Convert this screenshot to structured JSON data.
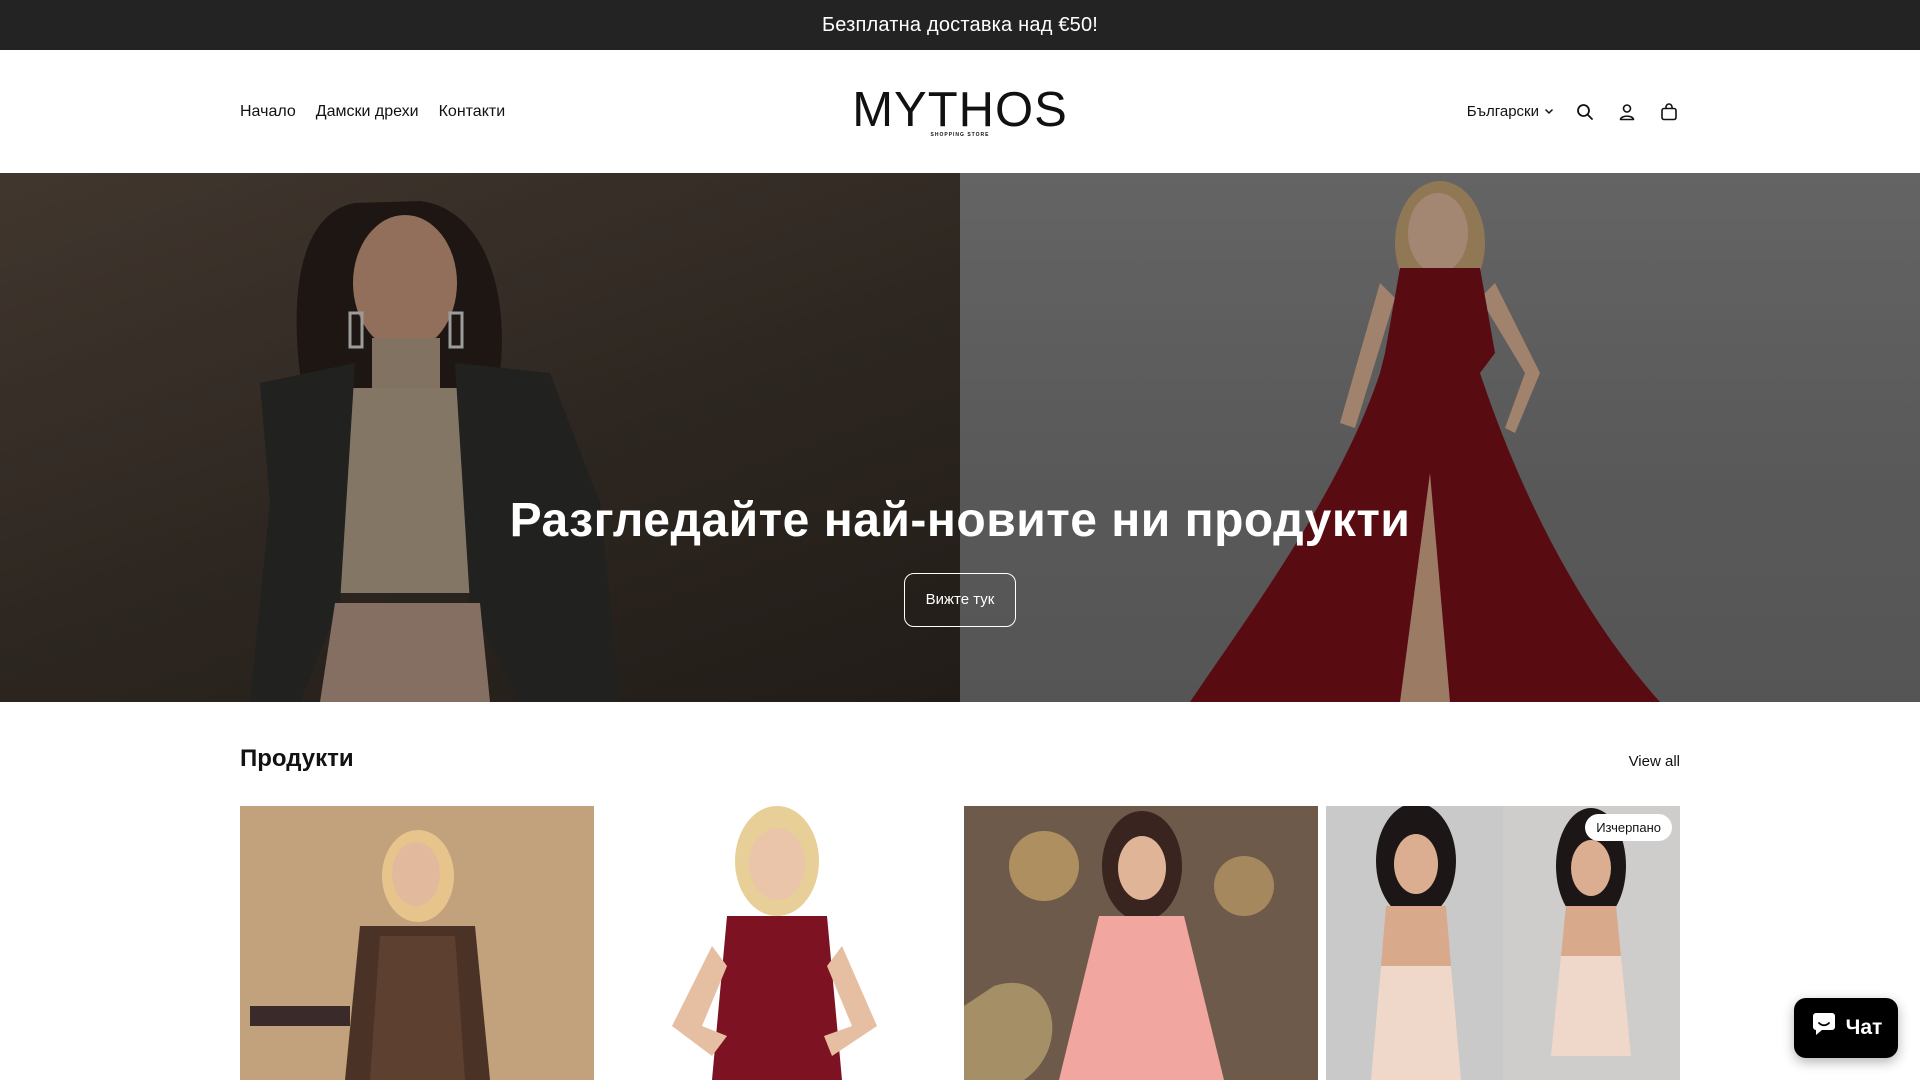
{
  "announcement": {
    "text": "Безплатна доставка над €50!"
  },
  "header": {
    "nav": [
      {
        "label": "Начало"
      },
      {
        "label": "Дамски дрехи"
      },
      {
        "label": "Контакти"
      }
    ],
    "logo": {
      "name": "MYTHOS",
      "tagline": "SHOPPING STORE"
    },
    "language": {
      "label": "Български"
    },
    "icons": [
      "search-icon",
      "account-icon",
      "cart-icon"
    ]
  },
  "hero": {
    "title": "Разгледайте най-новите ни продукти",
    "button_label": "Вижте тук"
  },
  "products": {
    "title": "Продукти",
    "view_all_label": "View all",
    "items": [
      {
        "image": "woman in leopard print wrap dress",
        "badge": ""
      },
      {
        "image": "woman in burgundy lace dress",
        "badge": ""
      },
      {
        "image": "woman in pink long sleeve maxi dress",
        "badge": ""
      },
      {
        "image": "woman in beige strapless jumpsuit",
        "badge": "Изчерпано"
      }
    ]
  },
  "chat": {
    "label": "Чат"
  },
  "colors": {
    "announcement_bg": "#232323",
    "accent": "#000000",
    "text": "#121212"
  }
}
